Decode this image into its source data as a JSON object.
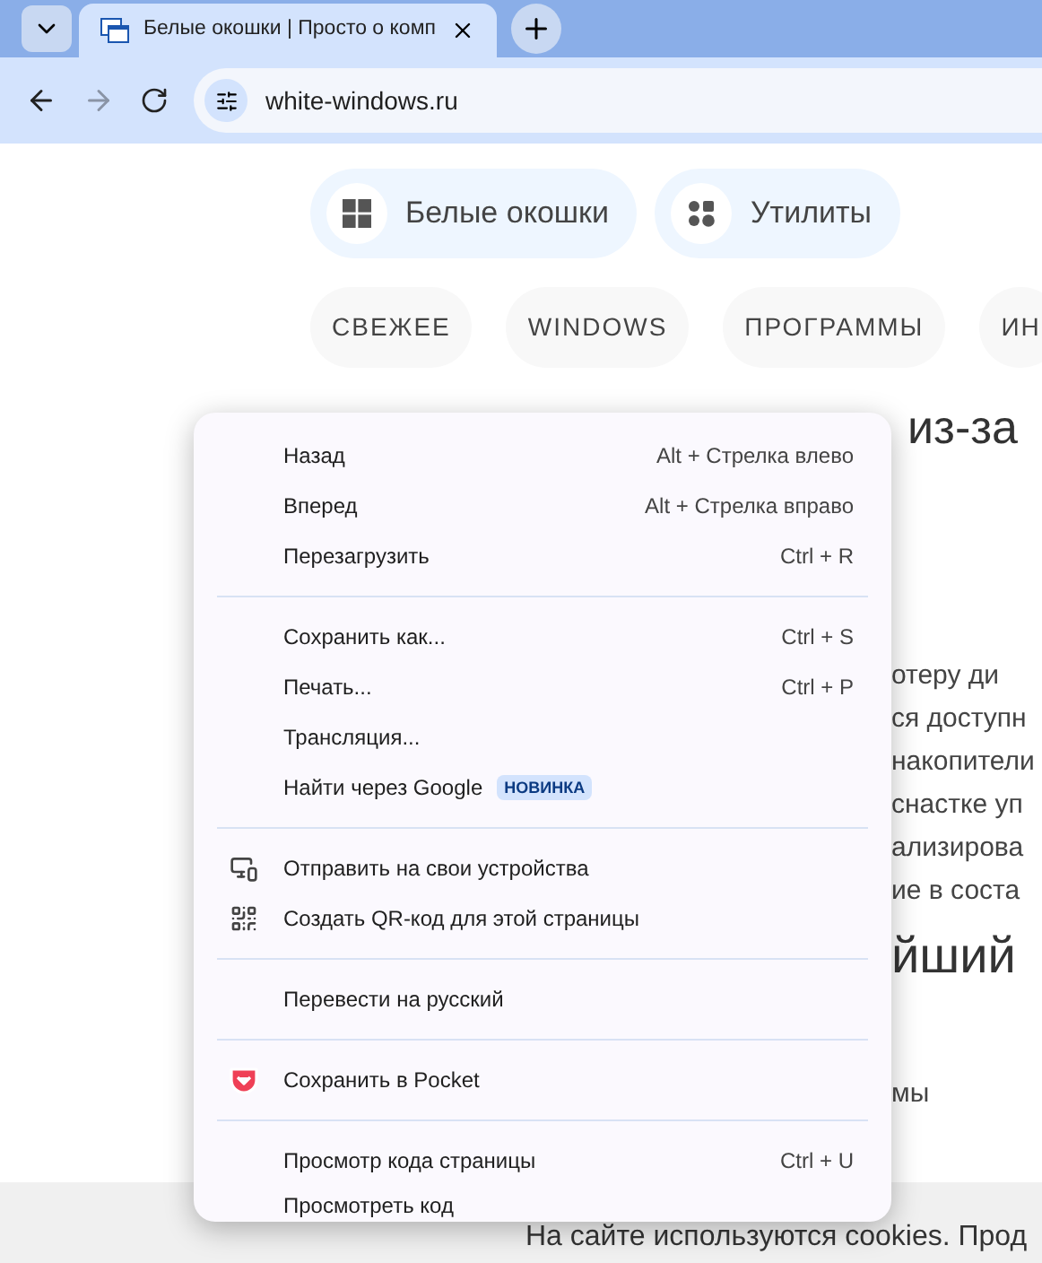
{
  "tab": {
    "title": "Белые окошки | Просто о комп"
  },
  "toolbar": {
    "back_disabled": false,
    "forward_disabled": true,
    "url": "white-windows.ru"
  },
  "site_nav": [
    "Белые окошки",
    "Утилиты"
  ],
  "categories": [
    "СВЕЖЕЕ",
    "WINDOWS",
    "ПРОГРАММЫ",
    "ИН"
  ],
  "article": {
    "heading_fragment": "из-за",
    "paragraph_fragments": [
      "отеру ди",
      "ся доступн",
      "накопители",
      "снастке уп",
      "ализирова",
      "ие в соста"
    ],
    "subheading_fragment": "йший",
    "line_fragment": "мы"
  },
  "cookie_bar": {
    "text": "На сайте используются cookies. Прод"
  },
  "context_menu": {
    "sections": [
      [
        {
          "label": "Назад",
          "shortcut": "Alt + Стрелка влево",
          "kind": "plain"
        },
        {
          "label": "Вперед",
          "shortcut": "Alt + Стрелка вправо",
          "kind": "plain"
        },
        {
          "label": "Перезагрузить",
          "shortcut": "Ctrl + R",
          "kind": "plain"
        }
      ],
      [
        {
          "label": "Сохранить как...",
          "shortcut": "Ctrl + S",
          "kind": "plain"
        },
        {
          "label": "Печать...",
          "shortcut": "Ctrl + P",
          "kind": "plain"
        },
        {
          "label": "Трансляция...",
          "kind": "plain"
        },
        {
          "label": "Найти через Google",
          "badge": "НОВИНКА",
          "kind": "plain"
        }
      ],
      [
        {
          "label": "Отправить на свои устройства",
          "kind": "devices"
        },
        {
          "label": "Создать QR-код для этой страницы",
          "kind": "qr"
        }
      ],
      [
        {
          "label": "Перевести на русский",
          "kind": "plain"
        }
      ],
      [
        {
          "label": "Сохранить в Pocket",
          "kind": "pocket"
        }
      ],
      [
        {
          "label": "Просмотр кода страницы",
          "shortcut": "Ctrl + U",
          "kind": "plain"
        },
        {
          "label": "Просмотреть код",
          "kind": "plain"
        }
      ]
    ]
  }
}
